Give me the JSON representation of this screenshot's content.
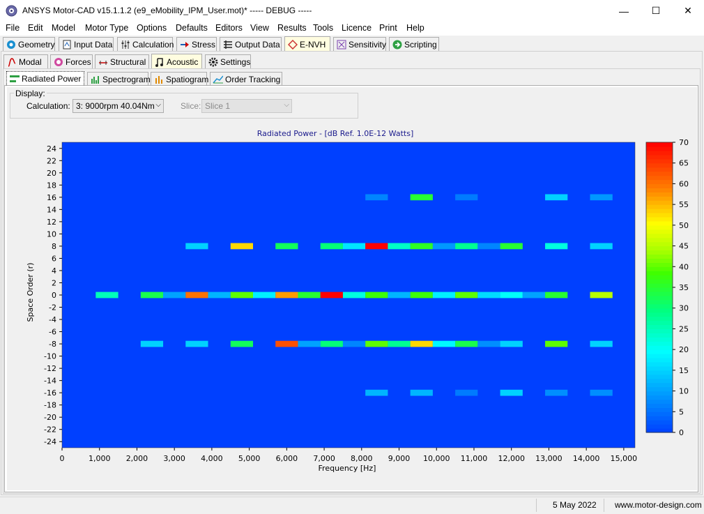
{
  "window": {
    "title": "ANSYS Motor-CAD v15.1.1.2 (e9_eMobility_IPM_User.mot)* ----- DEBUG -----",
    "minimize": "—",
    "maximize": "☐",
    "close": "✕"
  },
  "menu": [
    "File",
    "Edit",
    "Model",
    "Motor Type",
    "Options",
    "Defaults",
    "Editors",
    "View",
    "Results",
    "Tools",
    "Licence",
    "Print",
    "Help"
  ],
  "main_tabs": [
    {
      "label": "Geometry",
      "icon": "geometry-icon"
    },
    {
      "label": "Input Data",
      "icon": "input-data-icon"
    },
    {
      "label": "Calculation",
      "icon": "calculation-icon"
    },
    {
      "label": "Stress",
      "icon": "stress-icon"
    },
    {
      "label": "Output Data",
      "icon": "output-data-icon"
    },
    {
      "label": "E-NVH",
      "icon": "envh-icon",
      "active": true
    },
    {
      "label": "Sensitivity",
      "icon": "sensitivity-icon"
    },
    {
      "label": "Scripting",
      "icon": "scripting-icon"
    }
  ],
  "sub_tabs": [
    {
      "label": "Modal",
      "icon": "modal-icon"
    },
    {
      "label": "Forces",
      "icon": "forces-icon"
    },
    {
      "label": "Structural",
      "icon": "structural-icon"
    },
    {
      "label": "Acoustic",
      "icon": "acoustic-icon",
      "active": true
    },
    {
      "label": "Settings",
      "icon": "settings-gear-icon"
    }
  ],
  "acoustic_tabs": [
    {
      "label": "Radiated Power",
      "icon": "radiated-power-icon",
      "active": true
    },
    {
      "label": "Spectrogram",
      "icon": "spectrogram-icon"
    },
    {
      "label": "Spatiogram",
      "icon": "spatiogram-icon"
    },
    {
      "label": "Order Tracking",
      "icon": "order-tracking-icon"
    }
  ],
  "display": {
    "legend": "Display:",
    "calculation_label": "Calculation:",
    "calculation_value": "3:  9000rpm  40.04Nm",
    "slice_label": "Slice:",
    "slice_value": "Slice 1"
  },
  "chart_data": {
    "type": "heatmap",
    "title": "Radiated Power - [dB Ref. 1.0E-12 Watts]",
    "xlabel": "Frequency [Hz]",
    "ylabel": "Space Order (r)",
    "xlim": [
      0,
      15300
    ],
    "ylim": [
      -25,
      25
    ],
    "x_ticks": [
      "0",
      "1,000",
      "2,000",
      "3,000",
      "4,000",
      "5,000",
      "6,000",
      "7,000",
      "8,000",
      "9,000",
      "10,000",
      "11,000",
      "12,000",
      "13,000",
      "14,000",
      "15,000"
    ],
    "y_ticks": [
      "24",
      "22",
      "20",
      "18",
      "16",
      "14",
      "12",
      "10",
      "8",
      "6",
      "4",
      "2",
      "0",
      "-2",
      "-4",
      "-6",
      "-8",
      "-10",
      "-12",
      "-14",
      "-16",
      "-18",
      "-20",
      "-22",
      "-24"
    ],
    "colorbar_ticks": [
      "70",
      "65",
      "60",
      "55",
      "50",
      "45",
      "40",
      "35",
      "30",
      "25",
      "20",
      "15",
      "10",
      "5",
      "0"
    ],
    "colorbar_range": [
      0,
      70
    ],
    "background_level": 0,
    "bin_width_hz": 600,
    "cells": [
      {
        "f": 1200,
        "r": 0,
        "db": 25
      },
      {
        "f": 2400,
        "r": 0,
        "db": 33
      },
      {
        "f": 3000,
        "r": 0,
        "db": 10
      },
      {
        "f": 3600,
        "r": 0,
        "db": 60
      },
      {
        "f": 4200,
        "r": 0,
        "db": 12
      },
      {
        "f": 4800,
        "r": 0,
        "db": 40
      },
      {
        "f": 5400,
        "r": 0,
        "db": 18
      },
      {
        "f": 6000,
        "r": 0,
        "db": 57
      },
      {
        "f": 6600,
        "r": 0,
        "db": 35
      },
      {
        "f": 7200,
        "r": 0,
        "db": 70
      },
      {
        "f": 7800,
        "r": 0,
        "db": 22
      },
      {
        "f": 8400,
        "r": 0,
        "db": 38
      },
      {
        "f": 9000,
        "r": 0,
        "db": 12
      },
      {
        "f": 9600,
        "r": 0,
        "db": 38
      },
      {
        "f": 10200,
        "r": 0,
        "db": 18
      },
      {
        "f": 10800,
        "r": 0,
        "db": 40
      },
      {
        "f": 11400,
        "r": 0,
        "db": 16
      },
      {
        "f": 12000,
        "r": 0,
        "db": 20
      },
      {
        "f": 12600,
        "r": 0,
        "db": 10
      },
      {
        "f": 13200,
        "r": 0,
        "db": 35
      },
      {
        "f": 14400,
        "r": 0,
        "db": 45
      },
      {
        "f": 3600,
        "r": 8,
        "db": 15
      },
      {
        "f": 4800,
        "r": 8,
        "db": 53
      },
      {
        "f": 6000,
        "r": 8,
        "db": 32
      },
      {
        "f": 7200,
        "r": 8,
        "db": 30
      },
      {
        "f": 7800,
        "r": 8,
        "db": 17
      },
      {
        "f": 8400,
        "r": 8,
        "db": 70
      },
      {
        "f": 9000,
        "r": 8,
        "db": 24
      },
      {
        "f": 9600,
        "r": 8,
        "db": 36
      },
      {
        "f": 10200,
        "r": 8,
        "db": 9
      },
      {
        "f": 10800,
        "r": 8,
        "db": 28
      },
      {
        "f": 11400,
        "r": 8,
        "db": 7
      },
      {
        "f": 12000,
        "r": 8,
        "db": 35
      },
      {
        "f": 13200,
        "r": 8,
        "db": 22
      },
      {
        "f": 14400,
        "r": 8,
        "db": 15
      },
      {
        "f": 2400,
        "r": -8,
        "db": 15
      },
      {
        "f": 3600,
        "r": -8,
        "db": 15
      },
      {
        "f": 4800,
        "r": -8,
        "db": 32
      },
      {
        "f": 6000,
        "r": -8,
        "db": 63
      },
      {
        "f": 6600,
        "r": -8,
        "db": 10
      },
      {
        "f": 7200,
        "r": -8,
        "db": 30
      },
      {
        "f": 7800,
        "r": -8,
        "db": 7
      },
      {
        "f": 8400,
        "r": -8,
        "db": 40
      },
      {
        "f": 9000,
        "r": -8,
        "db": 28
      },
      {
        "f": 9600,
        "r": -8,
        "db": 53
      },
      {
        "f": 10200,
        "r": -8,
        "db": 19
      },
      {
        "f": 10800,
        "r": -8,
        "db": 33
      },
      {
        "f": 11400,
        "r": -8,
        "db": 8
      },
      {
        "f": 12000,
        "r": -8,
        "db": 15
      },
      {
        "f": 13200,
        "r": -8,
        "db": 40
      },
      {
        "f": 14400,
        "r": -8,
        "db": 15
      },
      {
        "f": 8400,
        "r": 16,
        "db": 7
      },
      {
        "f": 9600,
        "r": 16,
        "db": 35
      },
      {
        "f": 10800,
        "r": 16,
        "db": 6
      },
      {
        "f": 13200,
        "r": 16,
        "db": 15
      },
      {
        "f": 14400,
        "r": 16,
        "db": 9
      },
      {
        "f": 8400,
        "r": -16,
        "db": 12
      },
      {
        "f": 9600,
        "r": -16,
        "db": 12
      },
      {
        "f": 10800,
        "r": -16,
        "db": 6
      },
      {
        "f": 12000,
        "r": -16,
        "db": 15
      },
      {
        "f": 13200,
        "r": -16,
        "db": 8
      },
      {
        "f": 14400,
        "r": -16,
        "db": 8
      }
    ]
  },
  "status": {
    "date": "5 May 2022",
    "website": "www.motor-design.com"
  }
}
